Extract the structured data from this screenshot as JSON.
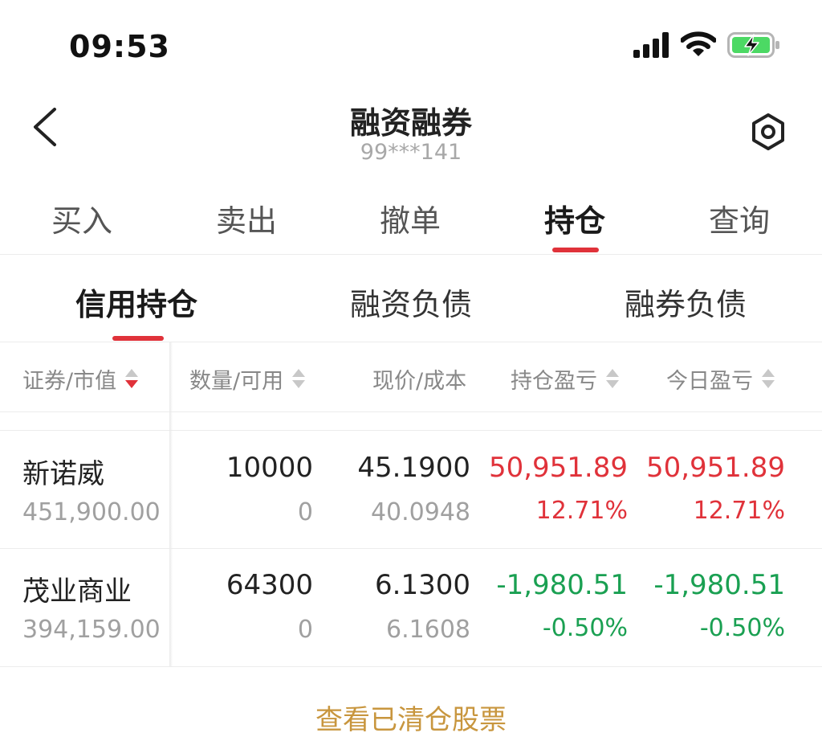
{
  "status_bar": {
    "time": "09:53"
  },
  "header": {
    "title": "融资融券",
    "account": "99***141"
  },
  "tabs": [
    {
      "label": "买入"
    },
    {
      "label": "卖出"
    },
    {
      "label": "撤单"
    },
    {
      "label": "持仓",
      "active": true
    },
    {
      "label": "查询"
    }
  ],
  "subtabs": [
    {
      "label": "信用持仓",
      "active": true
    },
    {
      "label": "融资负债"
    },
    {
      "label": "融券负债"
    }
  ],
  "columns": [
    {
      "label": "证券/市值",
      "sort": "desc"
    },
    {
      "label": "数量/可用",
      "sort": "none"
    },
    {
      "label": "现价/成本"
    },
    {
      "label": "持仓盈亏",
      "sort": "none"
    },
    {
      "label": "今日盈亏",
      "sort": "none"
    }
  ],
  "rows": [
    {
      "name": "新诺威",
      "market_value": "451,900.00",
      "quantity": "10000",
      "available": "0",
      "price": "45.1900",
      "cost": "40.0948",
      "pos_pnl": "50,951.89",
      "pos_pnl_pct": "12.71%",
      "day_pnl": "50,951.89",
      "day_pnl_pct": "12.71%",
      "trend": "up"
    },
    {
      "name": "茂业商业",
      "market_value": "394,159.00",
      "quantity": "64300",
      "available": "0",
      "price": "6.1300",
      "cost": "6.1608",
      "pos_pnl": "-1,980.51",
      "pos_pnl_pct": "-0.50%",
      "day_pnl": "-1,980.51",
      "day_pnl_pct": "-0.50%",
      "trend": "down"
    }
  ],
  "footer": {
    "link": "查看已清仓股票"
  },
  "colors": {
    "accent": "#e0323a",
    "gain": "#e0323a",
    "loss": "#1aa052",
    "link": "#c8963e"
  },
  "icons": {
    "back": "chevron-left-icon",
    "settings": "hexagon-gear-icon"
  }
}
